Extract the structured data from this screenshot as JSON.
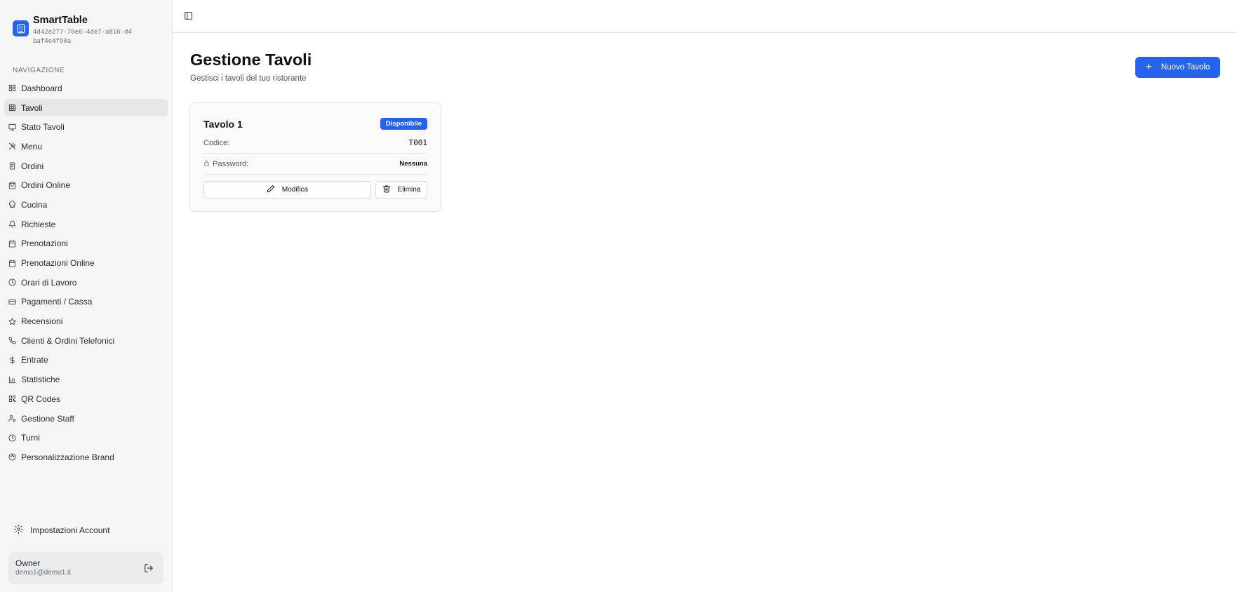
{
  "brand": {
    "name": "SmartTable",
    "id": "4d42e277-70e6-4de7-a816-d4baf4e4f90a"
  },
  "sidebar": {
    "heading": "NAVIGAZIONE",
    "items": [
      {
        "label": "Dashboard",
        "icon": "dashboard-icon"
      },
      {
        "label": "Tavoli",
        "icon": "table-grid-icon",
        "active": true
      },
      {
        "label": "Stato Tavoli",
        "icon": "monitor-icon"
      },
      {
        "label": "Menu",
        "icon": "utensils-icon"
      },
      {
        "label": "Ordini",
        "icon": "receipt-icon"
      },
      {
        "label": "Ordini Online",
        "icon": "shopping-bag-icon"
      },
      {
        "label": "Cucina",
        "icon": "chef-hat-icon"
      },
      {
        "label": "Richieste",
        "icon": "bell-icon"
      },
      {
        "label": "Prenotazioni",
        "icon": "calendar-icon"
      },
      {
        "label": "Prenotazioni Online",
        "icon": "calendar-icon"
      },
      {
        "label": "Orari di Lavoro",
        "icon": "clock-icon"
      },
      {
        "label": "Pagamenti / Cassa",
        "icon": "credit-card-icon"
      },
      {
        "label": "Recensioni",
        "icon": "star-icon"
      },
      {
        "label": "Clienti & Ordini Telefonici",
        "icon": "phone-icon"
      },
      {
        "label": "Entrate",
        "icon": "dollar-icon"
      },
      {
        "label": "Statistiche",
        "icon": "bar-chart-icon"
      },
      {
        "label": "QR Codes",
        "icon": "qr-code-icon"
      },
      {
        "label": "Gestione Staff",
        "icon": "user-cog-icon"
      },
      {
        "label": "Turni",
        "icon": "clock-icon"
      },
      {
        "label": "Personalizzazione Brand",
        "icon": "palette-icon"
      }
    ],
    "account_settings": "Impostazioni Account",
    "user": {
      "role": "Owner",
      "email": "demo1@demo1.it"
    }
  },
  "main": {
    "title": "Gestione Tavoli",
    "subtitle": "Gestisci i tavoli del tuo ristorante",
    "new_button": "Nuovo Tavolo"
  },
  "tables": [
    {
      "name": "Tavolo 1",
      "status": "Disponibile",
      "code_label": "Codice:",
      "code": "T001",
      "password_label": "Password:",
      "password": "Nessuna",
      "edit_label": "Modifica",
      "delete_label": "Elimina"
    }
  ],
  "colors": {
    "accent": "#2563eb",
    "sidebar_bg": "#f6f6f6"
  }
}
